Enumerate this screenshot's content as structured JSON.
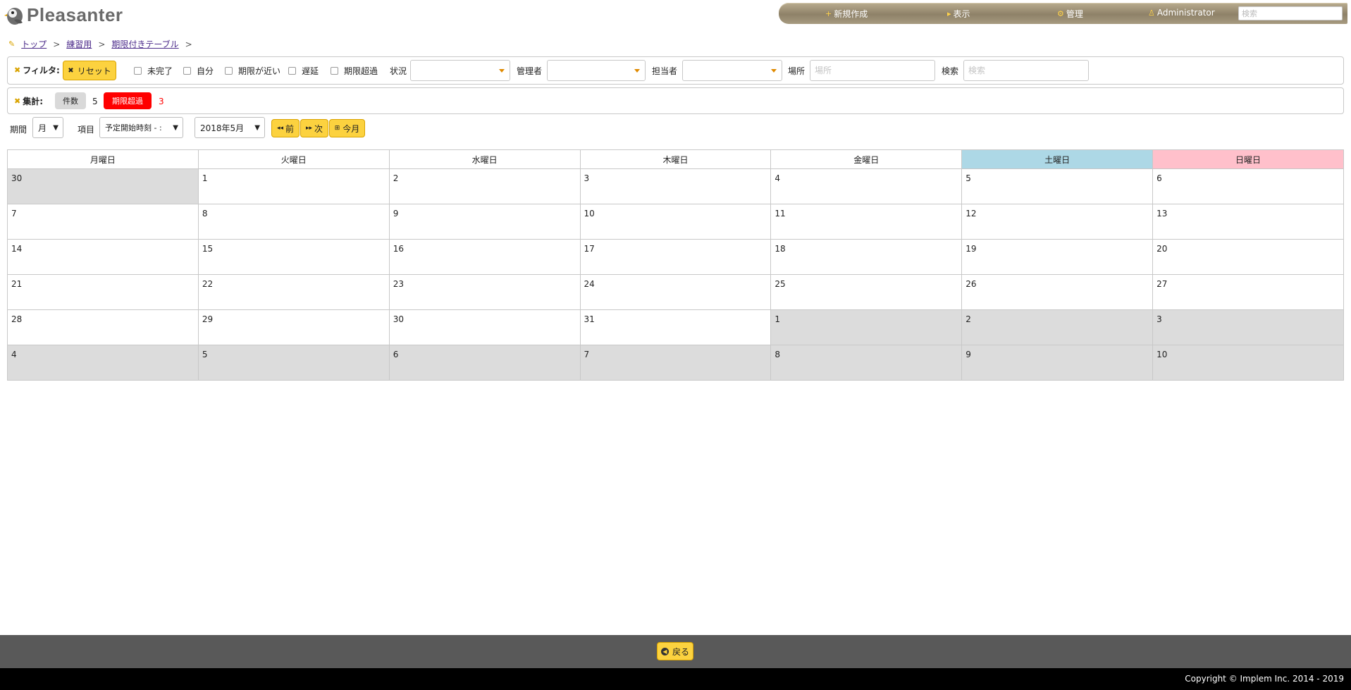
{
  "header": {
    "logo_text": "Pleasanter",
    "nav": {
      "new": "新規作成",
      "view": "表示",
      "admin": "管理",
      "user": "Administrator",
      "search_placeholder": "検索"
    }
  },
  "breadcrumb": {
    "items": [
      "トップ",
      "練習用",
      "期限付きテーブル"
    ],
    "separator": ">"
  },
  "filters": {
    "label": "フィルタ:",
    "reset": "リセット",
    "checkboxes": [
      "未完了",
      "自分",
      "期限が近い",
      "遅延",
      "期限超過"
    ],
    "status_label": "状況",
    "manager_label": "管理者",
    "owner_label": "担当者",
    "location_label": "場所",
    "location_placeholder": "場所",
    "search_label": "検索",
    "search_placeholder": "検索"
  },
  "aggregation": {
    "label": "集計:",
    "count_label": "件数",
    "count_value": "5",
    "overdue_label": "期限超過",
    "overdue_value": "3",
    "overdue_color": "#ff0000"
  },
  "controls": {
    "period_label": "期間",
    "period_value": "月",
    "item_label": "項目",
    "item_value": "予定開始時刻 - :",
    "month_value": "2018年5月",
    "prev": "前",
    "next": "次",
    "today": "今月"
  },
  "calendar": {
    "weekdays": [
      "月曜日",
      "火曜日",
      "水曜日",
      "木曜日",
      "金曜日",
      "土曜日",
      "日曜日"
    ],
    "saturday_color": "#add8e6",
    "sunday_color": "#ffc0cb",
    "weeks": [
      [
        "30",
        "1",
        "2",
        "3",
        "4",
        "5",
        "6"
      ],
      [
        "7",
        "8",
        "9",
        "10",
        "11",
        "12",
        "13"
      ],
      [
        "14",
        "15",
        "16",
        "17",
        "18",
        "19",
        "20"
      ],
      [
        "21",
        "22",
        "23",
        "24",
        "25",
        "26",
        "27"
      ],
      [
        "28",
        "29",
        "30",
        "31",
        "1",
        "2",
        "3"
      ],
      [
        "4",
        "5",
        "6",
        "7",
        "8",
        "9",
        "10"
      ]
    ]
  },
  "footer": {
    "back": "戻る",
    "copyright": "Copyright © Implem Inc. 2014 - 2019"
  }
}
